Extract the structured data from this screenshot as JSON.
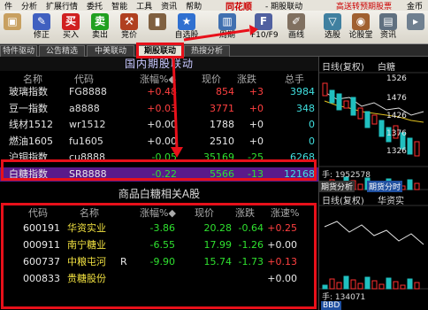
{
  "menubar": {
    "items": [
      "件",
      "分析",
      "扩展行情",
      "委托",
      "智能",
      "工具",
      "资讯",
      "帮助"
    ],
    "brand": "同花顺",
    "window_title": "- 期股联动",
    "promo": "高送转预期股票",
    "right": "金币"
  },
  "toolbar": {
    "buttons": [
      {
        "label": "",
        "icon": "box-icon",
        "color": "#c8a060"
      },
      {
        "label": "修正",
        "icon": "edit-icon",
        "color": "#4060c0"
      },
      {
        "label": "买入",
        "icon": "buy-icon",
        "glyph": "买",
        "color": "#d02020"
      },
      {
        "label": "卖出",
        "icon": "sell-icon",
        "glyph": "卖",
        "color": "#20a020"
      },
      {
        "label": "竞价",
        "icon": "gavel-icon",
        "color": "#b04020"
      },
      {
        "label": "",
        "icon": "lock-icon",
        "color": "#806040"
      },
      {
        "label": "自选股",
        "icon": "star-icon",
        "color": "#3070d0"
      },
      {
        "label": "周期",
        "icon": "bar-chart-icon",
        "color": "#4070b0"
      },
      {
        "label": "F10/F9",
        "icon": "f10-icon",
        "color": "#5060a0"
      },
      {
        "label": "画线",
        "icon": "pen-icon",
        "color": "#807060"
      },
      {
        "label": "选股",
        "icon": "filter-icon",
        "color": "#4080a0"
      },
      {
        "label": "论股堂",
        "icon": "chat-icon",
        "color": "#a06030"
      },
      {
        "label": "资讯",
        "icon": "news-icon",
        "color": "#607080"
      },
      {
        "label": "",
        "icon": "more-icon",
        "color": "#708090"
      }
    ]
  },
  "tabs": [
    "特件驱动",
    "公告精选",
    "中美联动",
    "期股联动",
    "热搜分析"
  ],
  "futures": {
    "title": "国内期股联动",
    "columns": [
      "名称",
      "代码",
      "涨幅%◆",
      "现价",
      "涨跌",
      "总手"
    ],
    "rows": [
      {
        "name": "玻璃指数",
        "code": "FG8888",
        "pct": "+0.48",
        "price": "854",
        "chg": "+3",
        "vol": "3984",
        "color": "red"
      },
      {
        "name": "豆一指数",
        "code": "a8888",
        "pct": "+0.03",
        "price": "3771",
        "chg": "+0",
        "vol": "348",
        "color": "red"
      },
      {
        "name": "线材1512",
        "code": "wr1512",
        "pct": "+0.00",
        "price": "1788",
        "chg": "+0",
        "vol": "0",
        "color": "white"
      },
      {
        "name": "燃油1605",
        "code": "fu1605",
        "pct": "+0.00",
        "price": "2510",
        "chg": "+0",
        "vol": "0",
        "color": "white"
      },
      {
        "name": "沪铜指数",
        "code": "cu8888",
        "pct": "-0.05",
        "price": "35169",
        "chg": "-25",
        "vol": "6268",
        "color": "green"
      },
      {
        "name": "白糖指数",
        "code": "SR8888",
        "pct": "-0.22",
        "price": "5566",
        "chg": "-13",
        "vol": "12168",
        "color": "green"
      }
    ]
  },
  "stocks": {
    "title": "商品白糖相关A股",
    "columns": [
      "代码",
      "名称",
      "涨幅%◆",
      "现价",
      "涨跌",
      "涨速%"
    ],
    "rows": [
      {
        "code": "600191",
        "name": "华资实业",
        "flag": "",
        "pct": "-3.86",
        "price": "20.28",
        "chg": "-0.64",
        "speed": "+0.25",
        "color": "green",
        "speed_color": "red"
      },
      {
        "code": "000911",
        "name": "南宁糖业",
        "flag": "",
        "pct": "-6.55",
        "price": "17.99",
        "chg": "-1.26",
        "speed": "+0.00",
        "color": "green",
        "speed_color": "white"
      },
      {
        "code": "600737",
        "name": "中粮屯河",
        "flag": "R",
        "pct": "-9.90",
        "price": "15.74",
        "chg": "-1.73",
        "speed": "+0.13",
        "color": "green",
        "speed_color": "red"
      },
      {
        "code": "000833",
        "name": "贵糖股份",
        "flag": "",
        "pct": "",
        "price": "",
        "chg": "",
        "speed": "+0.00",
        "color": "white",
        "speed_color": "white"
      }
    ]
  },
  "chart": {
    "top_label": "日线(复权)",
    "top_label2": "白糖",
    "values": [
      "1526",
      "1476",
      "1426",
      "1376",
      "1326"
    ],
    "vol1": "手: 1952578",
    "tab1": "期货分析",
    "tab2": "期货分时",
    "label3": "日线(复权)",
    "label4": "华资实",
    "vol2": "手: 134071",
    "badge": "BBD"
  }
}
